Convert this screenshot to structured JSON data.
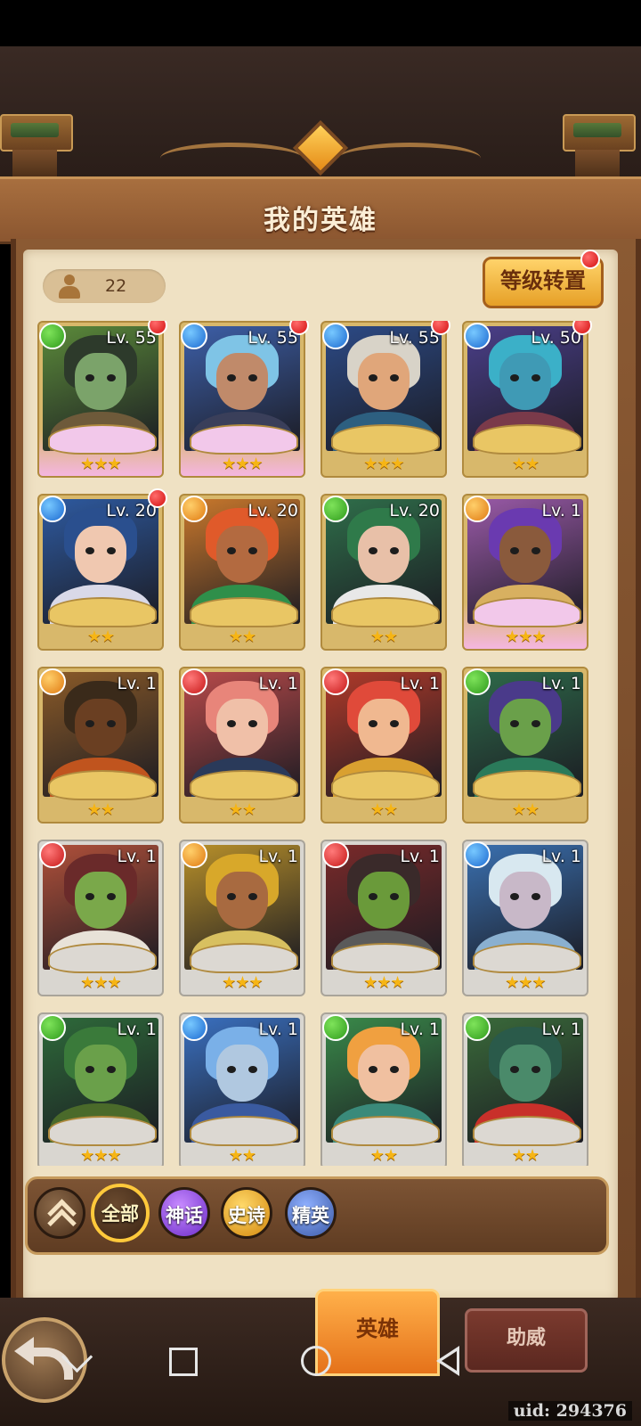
{
  "header": {
    "title": "我的英雄"
  },
  "hero_count": "22",
  "level_transfer": {
    "label": "等级转置",
    "has_notification": true
  },
  "heroes": [
    {
      "level": "Lv. 55",
      "faction": "green",
      "stars": "★★★",
      "notify": true,
      "tier": "pink",
      "colors": [
        "#5b8a3a",
        "#2d3a2b",
        "#7ba36a",
        "#6e5a3a"
      ]
    },
    {
      "level": "Lv. 55",
      "faction": "blue",
      "stars": "★★★",
      "notify": true,
      "tier": "pink",
      "colors": [
        "#3d5fa8",
        "#7fc4e6",
        "#c08a6a",
        "#3a3f5a"
      ]
    },
    {
      "level": "Lv. 55",
      "faction": "blue",
      "stars": "★★★",
      "notify": true,
      "tier": "gold",
      "colors": [
        "#2c4a86",
        "#d8d3c8",
        "#e0a67a",
        "#2d5f80"
      ]
    },
    {
      "level": "Lv. 50",
      "faction": "blue",
      "stars": "★★",
      "notify": true,
      "tier": "gold",
      "colors": [
        "#4b3f8a",
        "#3bb0c8",
        "#3f9ab5",
        "#7a3a4a"
      ]
    },
    {
      "level": "Lv. 20",
      "faction": "blue",
      "stars": "★★",
      "notify": true,
      "tier": "gold",
      "colors": [
        "#2e5aa0",
        "#2a4f8e",
        "#f0c8b0",
        "#d9d9e8"
      ]
    },
    {
      "level": "Lv. 20",
      "faction": "orange",
      "stars": "★★",
      "notify": false,
      "tier": "gold",
      "colors": [
        "#c9782c",
        "#e05a2a",
        "#b36a40",
        "#2f8f4a"
      ]
    },
    {
      "level": "Lv. 20",
      "faction": "green",
      "stars": "★★",
      "notify": false,
      "tier": "gold",
      "colors": [
        "#2f6e4a",
        "#2f7a4a",
        "#e8c0a8",
        "#e8e8e8"
      ]
    },
    {
      "level": "Lv. 1",
      "faction": "orange",
      "stars": "★★★",
      "notify": false,
      "tier": "pink",
      "colors": [
        "#9a5aa8",
        "#6a3ab0",
        "#8a5a3c",
        "#d8b060"
      ]
    },
    {
      "level": "Lv. 1",
      "faction": "orange",
      "stars": "★★",
      "notify": false,
      "tier": "gold",
      "colors": [
        "#8a5a28",
        "#3a2a1a",
        "#6a3f22",
        "#c0541e"
      ]
    },
    {
      "level": "Lv. 1",
      "faction": "red",
      "stars": "★★",
      "notify": false,
      "tier": "gold",
      "colors": [
        "#b84a4a",
        "#e8857a",
        "#f0c0a8",
        "#2a3a5a"
      ]
    },
    {
      "level": "Lv. 1",
      "faction": "red",
      "stars": "★★",
      "notify": false,
      "tier": "gold",
      "colors": [
        "#b03a2a",
        "#e04a3a",
        "#f0b890",
        "#d9a030"
      ]
    },
    {
      "level": "Lv. 1",
      "faction": "green",
      "stars": "★★",
      "notify": false,
      "tier": "gold",
      "colors": [
        "#2e6a4a",
        "#4a3a8a",
        "#6aa04a",
        "#2a7a5a"
      ]
    },
    {
      "level": "Lv. 1",
      "faction": "red",
      "stars": "★★★",
      "notify": false,
      "tier": "silver",
      "colors": [
        "#b0503a",
        "#6a2a2a",
        "#7aa84a",
        "#e8e2d8"
      ]
    },
    {
      "level": "Lv. 1",
      "faction": "orange",
      "stars": "★★★",
      "notify": false,
      "tier": "silver",
      "colors": [
        "#b8902a",
        "#d8a82a",
        "#a86a40",
        "#d8c060"
      ]
    },
    {
      "level": "Lv. 1",
      "faction": "red",
      "stars": "★★★",
      "notify": false,
      "tier": "silver",
      "colors": [
        "#7a2a2a",
        "#3a2a2a",
        "#6a9a3a",
        "#5a5a5a"
      ]
    },
    {
      "level": "Lv. 1",
      "faction": "blue",
      "stars": "★★★",
      "notify": false,
      "tier": "silver",
      "colors": [
        "#3a70b0",
        "#d8e8f0",
        "#c8b8c8",
        "#8ab0d0"
      ]
    },
    {
      "level": "Lv. 1",
      "faction": "green",
      "stars": "★★★",
      "notify": false,
      "tier": "silver",
      "colors": [
        "#2e6a3a",
        "#3a7a3a",
        "#6aa04a",
        "#4a6a2a"
      ]
    },
    {
      "level": "Lv. 1",
      "faction": "blue",
      "stars": "★★",
      "notify": false,
      "tier": "silver",
      "colors": [
        "#3a70c0",
        "#7ab0e8",
        "#b0c8e0",
        "#3a5aa0"
      ]
    },
    {
      "level": "Lv. 1",
      "faction": "green",
      "stars": "★★",
      "notify": false,
      "tier": "silver",
      "colors": [
        "#3a8a4a",
        "#f0a040",
        "#f0c0a0",
        "#3a8a7a"
      ]
    },
    {
      "level": "Lv. 1",
      "faction": "green",
      "stars": "★★",
      "notify": false,
      "tier": "silver",
      "colors": [
        "#3a6a3a",
        "#2a5a4a",
        "#4a8a6a",
        "#c8302a"
      ]
    }
  ],
  "filters": [
    {
      "label": "全部",
      "selected": true
    },
    {
      "label": "神话",
      "selected": false
    },
    {
      "label": "史诗",
      "selected": false
    },
    {
      "label": "精英",
      "selected": false
    }
  ],
  "tabs": {
    "hero": "英雄",
    "assist": "助威"
  },
  "uid_text": "uid: 294376"
}
